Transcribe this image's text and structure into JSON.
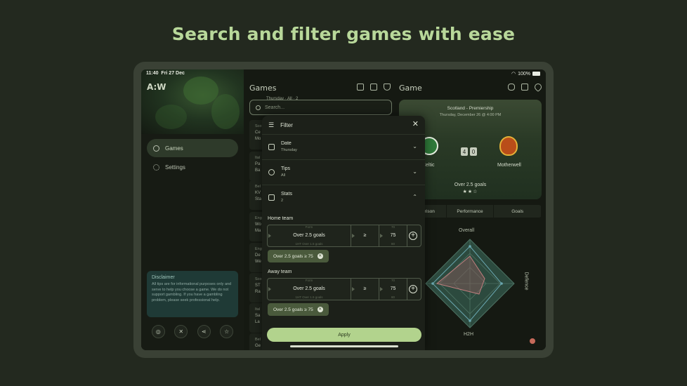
{
  "headline": "Search and filter games with ease",
  "status": {
    "time": "11:40",
    "date": "Fri 27 Dec",
    "battery": "100%"
  },
  "nav": {
    "logo": "A:W",
    "items": [
      {
        "label": "Games",
        "icon": "football-icon"
      },
      {
        "label": "Settings",
        "icon": "gear-icon"
      }
    ],
    "disclaimer_title": "Disclaimer",
    "disclaimer_text": "All tips are for informational purposes only and serve to help you choose a game. We do not support gambling. If you have a gambling problem, please seek professional help.",
    "socials": [
      "instagram-icon",
      "x-icon",
      "share-icon",
      "star-icon"
    ]
  },
  "games": {
    "title": "Games",
    "chips": "Thursday · All · 2",
    "search_placeholder": "Search...",
    "list": [
      {
        "league": "Sco",
        "line1": "Ce",
        "line2": "Mo"
      },
      {
        "league": "Ital",
        "line1": "Pa",
        "line2": "Ba"
      },
      {
        "league": "Bel",
        "line1": "KV",
        "line2": "Sta"
      },
      {
        "league": "Eng",
        "line1": "Wo",
        "line2": "Ma"
      },
      {
        "league": "Eng",
        "line1": "De",
        "line2": "We"
      },
      {
        "league": "Sco",
        "line1": "ST",
        "line2": "Ra"
      },
      {
        "league": "Ital",
        "line1": "Sa",
        "line2": "La"
      },
      {
        "league": "Bel",
        "line1": "Ge",
        "line2": "Un"
      }
    ]
  },
  "game": {
    "title": "Game",
    "league": "Scotland - Premiership",
    "date": "Thursday, December 26 @ 4:00 PM",
    "home": "Celtic",
    "away": "Motherwell",
    "score_home": "4",
    "score_away": "0",
    "tip": "Over 2.5 goals",
    "stars": "★★☆",
    "tabs": [
      "Comparison",
      "Performance",
      "Goals"
    ],
    "radar_labels": {
      "top": "Overall",
      "right": "Defence",
      "bottom": "H2H"
    }
  },
  "filter": {
    "title": "Filter",
    "rows": [
      {
        "title": "Date",
        "value": "Thursday"
      },
      {
        "title": "Tips",
        "value": "All"
      },
      {
        "title": "Stats",
        "value": "2"
      }
    ],
    "home_label": "Home team",
    "away_label": "Away team",
    "stat": "Over 2.5 goals",
    "stat_above": "Form",
    "stat_below": "1HT Over 1.5 goals",
    "operator": "≥",
    "value": "75",
    "value_above": "70",
    "value_below": "80",
    "home_pill": "Over 2.5 goals ≥ 75",
    "away_pill": "Over 2.5 goals ≥ 75",
    "apply_label": "Apply"
  }
}
